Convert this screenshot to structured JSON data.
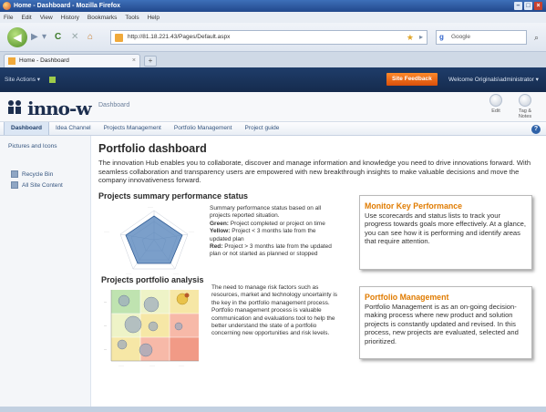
{
  "browser": {
    "window_title": "Home - Dashboard - Mozilla Firefox",
    "menu": [
      "File",
      "Edit",
      "View",
      "History",
      "Bookmarks",
      "Tools",
      "Help"
    ],
    "url": "http://81.18.221.43/Pages/Default.aspx",
    "search_placeholder": "Google",
    "tab_title": "Home - Dashboard"
  },
  "sharepoint": {
    "site_actions": "Site Actions",
    "feedback_label": "Site Feedback",
    "user_label": "Welcome Originals\\administrator"
  },
  "site": {
    "logo_text": "inno-w",
    "breadcrumb": "Dashboard",
    "header_icons": [
      {
        "label": "Edit",
        "icon": "edit-icon"
      },
      {
        "label": "Tag & Notes",
        "icon": "tag-icon"
      }
    ]
  },
  "topnav": {
    "items": [
      "Dashboard",
      "Idea Channel",
      "Projects Management",
      "Portfolio Management",
      "Project guide"
    ],
    "active_index": 0
  },
  "leftnav": {
    "quick_link": "Pictures and Icons",
    "links": [
      {
        "label": "Recycle Bin",
        "icon": "recycle-bin-icon"
      },
      {
        "label": "All Site Content",
        "icon": "site-content-icon"
      }
    ]
  },
  "page": {
    "title": "Portfolio dashboard",
    "intro": "The innovation Hub enables you to collaborate, discover and manage information and knowledge  you need to drive  innovations forward.  With seamless collaboration and transparency users are empowered with new breakthrough  insights to make valuable decisions and move the company innovativeness forward.",
    "summary": {
      "title": "Projects summary performance status",
      "desc_intro": "Summary performance status based on all projects reported situation.",
      "green_label": "Green:",
      "green_text": "Project completed or project on time",
      "yellow_label": "Yellow:",
      "yellow_text": "Project < 3 months late from the updated plan",
      "red_label": "Red:",
      "red_text": "Project > 3 months late from the updated plan or not started as planned or stopped"
    },
    "portfolio": {
      "title": "Projects portfolio analysis",
      "desc": "The need to manage risk factors such as resources, market and technology uncertainty is the key in the portfolio management process. Portfolio management process is valuable communication and evaluations tool to help the better understand the state of a portfolio concerning new opportunities and risk levels."
    },
    "cards": [
      {
        "title": "Monitor Key Performance",
        "body": "Use scorecards and status lists to track your progress towards goals more effectively. At a glance, you can see how it is performing and identify areas that require attention."
      },
      {
        "title": "Portfolio Management",
        "body": "Portfolio Management is as an on-going decision-making process where new product and solution projects is constantly updated and revised.  In this process, new projects are evaluated, selected and prioritized."
      }
    ]
  },
  "colors": {
    "ribbon": "#1f3d6a",
    "feedback": "#ff8a2a",
    "card_title": "#e07b00",
    "radar_fill": "#4f7fb8"
  }
}
